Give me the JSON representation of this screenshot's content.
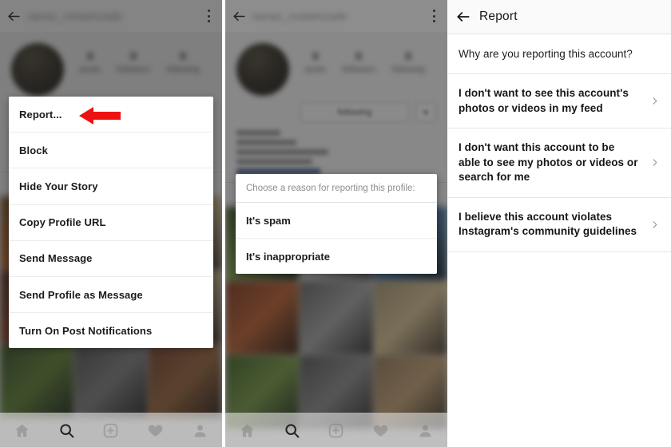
{
  "panel1": {
    "header": {
      "username": "sanaz_rostamzade",
      "back_icon": "back-arrow-icon",
      "overflow_icon": "vertical-dots-icon"
    },
    "profile": {
      "stats": [
        {
          "value": "0",
          "label": "posts"
        },
        {
          "value": "0",
          "label": "followers"
        },
        {
          "value": "0",
          "label": "following"
        }
      ],
      "follow_button": "following"
    },
    "menu": {
      "items": [
        "Report...",
        "Block",
        "Hide Your Story",
        "Copy Profile URL",
        "Send Message",
        "Send Profile as Message",
        "Turn On Post Notifications"
      ]
    },
    "annotation": {
      "arrow_icon": "left-arrow-annotation-icon",
      "arrow_color": "#ee1111"
    }
  },
  "panel2": {
    "header": {
      "username": "sanaz_rostamzade",
      "back_icon": "back-arrow-icon",
      "overflow_icon": "vertical-dots-icon"
    },
    "dialog": {
      "title": "Choose a reason for reporting this profile:",
      "options": [
        "It's spam",
        "It's inappropriate"
      ]
    }
  },
  "panel3": {
    "header": {
      "title": "Report",
      "back_icon": "back-arrow-icon"
    },
    "question": "Why are you reporting this account?",
    "reasons": [
      {
        "label": "I don't want to see this account's photos or videos in my feed",
        "chevron": "chevron-right-icon"
      },
      {
        "label": "I don't want this account to be able to see my photos or videos or search for me",
        "chevron": "chevron-right-icon"
      },
      {
        "label": "I believe this account violates Instagram's community guidelines",
        "chevron": "chevron-right-icon"
      }
    ]
  },
  "tabbar": {
    "items": [
      {
        "name": "home-icon",
        "label": "Home"
      },
      {
        "name": "search-icon",
        "label": "Search"
      },
      {
        "name": "add-post-icon",
        "label": "Add"
      },
      {
        "name": "activity-heart-icon",
        "label": "Activity"
      },
      {
        "name": "profile-person-icon",
        "label": "Profile"
      }
    ]
  },
  "colors": {
    "accent_red": "#ee1111",
    "surface": "#ffffff",
    "text": "#161616",
    "muted": "#8d8d8d"
  }
}
